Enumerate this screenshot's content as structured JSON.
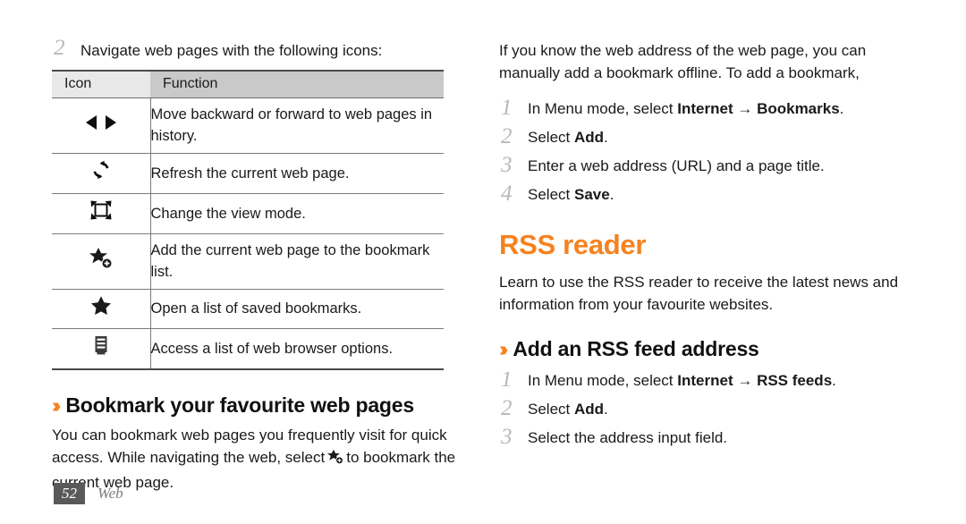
{
  "document": {
    "page_number": "52",
    "section_label": "Web"
  },
  "left_column": {
    "intro_step": {
      "number": "2",
      "text": "Navigate web pages with the following icons:"
    },
    "table": {
      "headers": [
        "Icon",
        "Function"
      ],
      "rows": [
        {
          "icon": "back-forward-arrows-icon",
          "function": "Move backward or forward to web pages in history."
        },
        {
          "icon": "refresh-icon",
          "function": "Refresh the current web page."
        },
        {
          "icon": "view-mode-icon",
          "function": "Change the view mode."
        },
        {
          "icon": "add-bookmark-icon",
          "function": "Add the current web page to the bookmark list."
        },
        {
          "icon": "bookmark-star-icon",
          "function": "Open a list of saved bookmarks."
        },
        {
          "icon": "browser-options-icon",
          "function": "Access a list of web browser options."
        }
      ]
    },
    "heading": {
      "chevron": "››",
      "text": "Bookmark your favourite web pages"
    },
    "paragraph_part1": "You can bookmark web pages you frequently visit for quick access. While navigating the web, select",
    "paragraph_part2": "to bookmark the current web page."
  },
  "right_column": {
    "intro_paragraph": "If you know the web address of the web page, you can manually add a bookmark offline. To add a bookmark,",
    "bookmark_steps": [
      {
        "number": "1",
        "prefix": "In Menu mode, select ",
        "bold1": "Internet",
        "arrow": " → ",
        "bold2": "Bookmarks",
        "suffix": "."
      },
      {
        "number": "2",
        "prefix": "Select ",
        "bold1": "Add",
        "arrow": "",
        "bold2": "",
        "suffix": "."
      },
      {
        "number": "3",
        "prefix": "Enter a web address (URL) and a page title.",
        "bold1": "",
        "arrow": "",
        "bold2": "",
        "suffix": ""
      },
      {
        "number": "4",
        "prefix": "Select ",
        "bold1": "Save",
        "arrow": "",
        "bold2": "",
        "suffix": "."
      }
    ],
    "section_title": "RSS reader",
    "section_paragraph": "Learn to use the RSS reader to receive the latest news and information from your favourite websites.",
    "heading": {
      "chevron": "››",
      "text": "Add an RSS feed address"
    },
    "rss_steps": [
      {
        "number": "1",
        "prefix": "In Menu mode, select ",
        "bold1": "Internet",
        "arrow": " → ",
        "bold2": "RSS feeds",
        "suffix": "."
      },
      {
        "number": "2",
        "prefix": "Select ",
        "bold1": "Add",
        "arrow": "",
        "bold2": "",
        "suffix": "."
      },
      {
        "number": "3",
        "prefix": "Select the address input field.",
        "bold1": "",
        "arrow": "",
        "bold2": "",
        "suffix": ""
      }
    ]
  },
  "colors": {
    "accent_orange": "#f5821f",
    "step_number_gray": "#b8b8b8",
    "table_header_icon_bg": "#e9e9e9",
    "table_header_function_bg": "#c9c9c9",
    "footer_badge_bg": "#595959",
    "text": "#1a1a1a"
  }
}
